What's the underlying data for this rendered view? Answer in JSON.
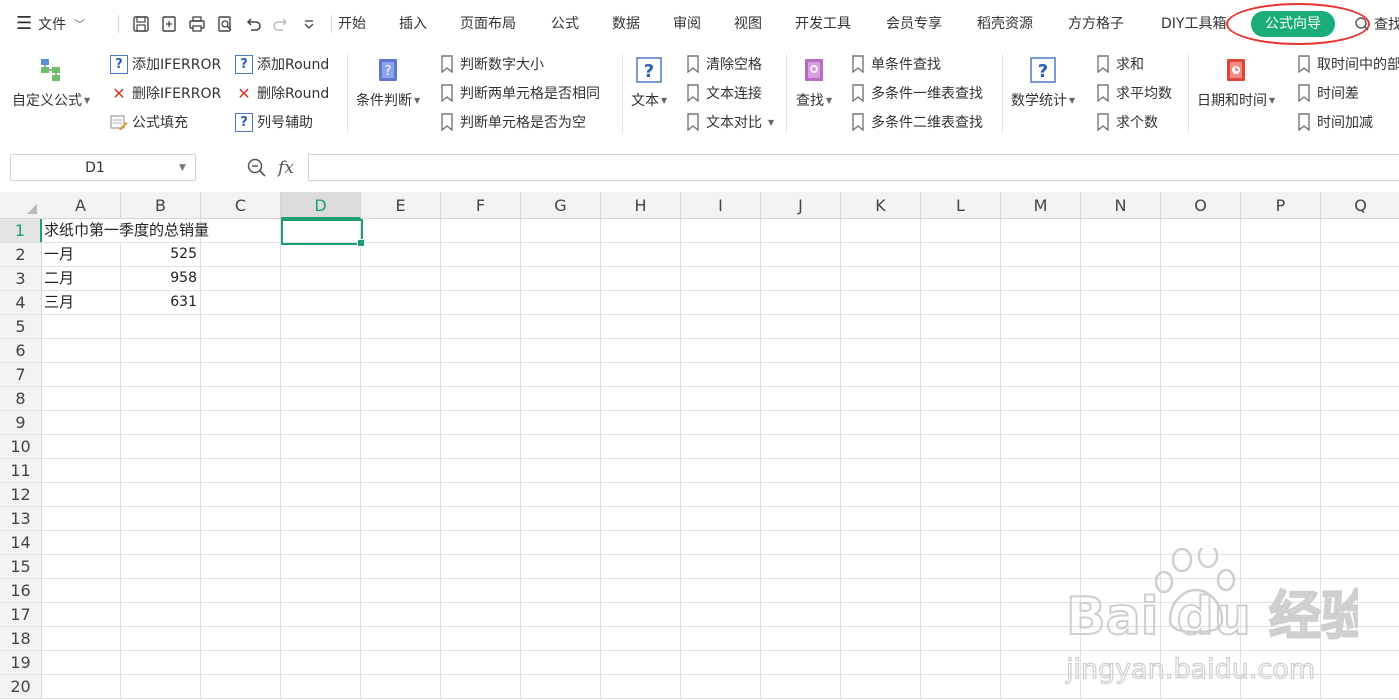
{
  "menubar": {
    "file_label": "文件",
    "tabs": [
      "开始",
      "插入",
      "页面布局",
      "公式",
      "数据",
      "审阅",
      "视图",
      "开发工具",
      "会员专享",
      "稻壳资源",
      "方方格子",
      "DIY工具箱"
    ],
    "active_tab": "公式向导",
    "search_label": "查找"
  },
  "ribbon": {
    "custom_formula": "自定义公式",
    "add_iferror": "添加IFERROR",
    "del_iferror": "删除IFERROR",
    "formula_fill": "公式填充",
    "add_round": "添加Round",
    "del_round": "删除Round",
    "col_helper": "列号辅助",
    "cond_judge": "条件判断",
    "judge_num_size": "判断数字大小",
    "judge_two_same": "判断两单元格是否相同",
    "judge_empty": "判断单元格是否为空",
    "text": "文本",
    "clear_space": "清除空格",
    "text_concat": "文本连接",
    "text_compare": "文本对比",
    "lookup": "查找",
    "single_lookup": "单条件查找",
    "multi_1d_lookup": "多条件一维表查找",
    "multi_2d_lookup": "多条件二维表查找",
    "stats": "数学统计",
    "sum": "求和",
    "average": "求平均数",
    "count": "求个数",
    "datetime": "日期和时间",
    "extract_time": "取时间中的部",
    "time_diff": "时间差",
    "time_add": "时间加减"
  },
  "formula_bar": {
    "name_box": "D1",
    "fx": "fx",
    "formula": ""
  },
  "sheet": {
    "columns": [
      "A",
      "B",
      "C",
      "D",
      "E",
      "F",
      "G",
      "H",
      "I",
      "J",
      "K",
      "L",
      "M",
      "N",
      "O",
      "P",
      "Q"
    ],
    "rows": [
      "1",
      "2",
      "3",
      "4",
      "5",
      "6",
      "7",
      "8",
      "9",
      "10",
      "11",
      "12",
      "13",
      "14",
      "15",
      "16",
      "17",
      "18",
      "19",
      "20"
    ],
    "selected_column": "D",
    "selected_row": "1",
    "cells": {
      "A1": "求纸巾第一季度的总销量",
      "A2": "一月",
      "B2": "525",
      "A3": "二月",
      "B3": "958",
      "A4": "三月",
      "B4": "631"
    }
  },
  "watermark": {
    "brand": "Bai du 经验",
    "url": "jingyan.baidu.com"
  },
  "colors": {
    "accent_green": "#1aad78",
    "selection_green": "#1f9e6e",
    "highlight_red": "#e8332f"
  }
}
